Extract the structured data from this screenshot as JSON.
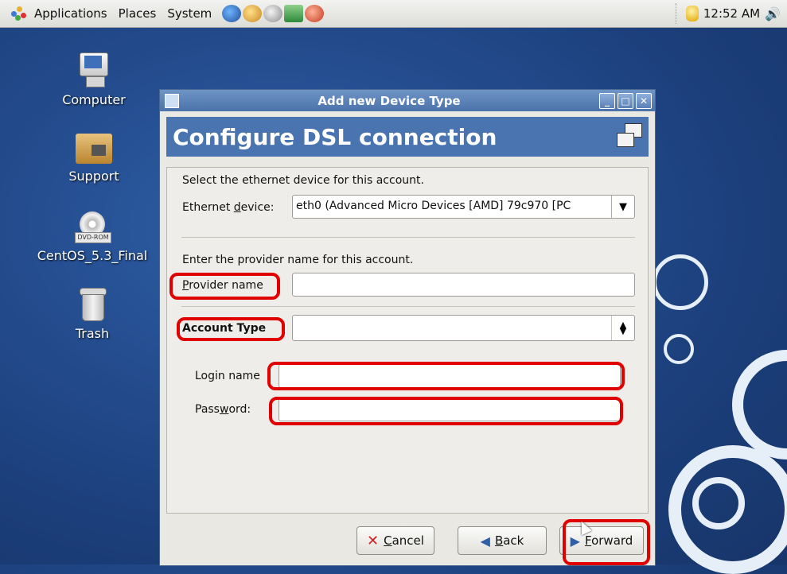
{
  "panel": {
    "menus": [
      "Applications",
      "Places",
      "System"
    ],
    "clock": "12:52 AM"
  },
  "desktop": {
    "icons": [
      {
        "label": "Computer"
      },
      {
        "label": "Support"
      },
      {
        "label": "CentOS_5.3_Final",
        "badge": "DVD-ROM"
      },
      {
        "label": "Trash"
      }
    ]
  },
  "dialog": {
    "title": "Add new Device Type",
    "header": "Configure DSL connection",
    "ethernet_prompt": "Select the ethernet device for this account.",
    "ethernet_label_pre": "Ethernet ",
    "ethernet_label_mnemonic": "d",
    "ethernet_label_post": "evice:",
    "ethernet_value": "eth0 (Advanced Micro Devices [AMD] 79c970 [PC",
    "provider_prompt": "Enter the provider name for this account.",
    "provider_label_mnemonic": "P",
    "provider_label_rest": "rovider name",
    "provider_value": "",
    "account_type_label": "Account Type",
    "account_type_value": "",
    "login_label": "Login name",
    "login_value": "",
    "password_label_pre": "Pass",
    "password_label_mnemonic": "w",
    "password_label_post": "ord:",
    "password_value": "",
    "buttons": {
      "cancel_mnemonic": "C",
      "cancel_rest": "ancel",
      "back_mnemonic": "B",
      "back_rest": "ack",
      "forward_mnemonic": "F",
      "forward_rest": "orward"
    }
  },
  "colors": {
    "annotation": "#e00000",
    "header_bg": "#4a74b0",
    "titlebar": "#5b80b7"
  }
}
